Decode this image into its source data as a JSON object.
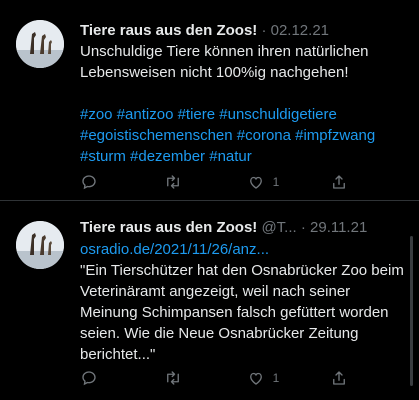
{
  "tweets": [
    {
      "name": "Tiere raus aus den Zoos!",
      "meta": "· 02.12.21",
      "text": "Unschuldige Tiere können ihren natürlichen Lebensweisen nicht 100%ig nachgehen!",
      "hashtags": "#zoo #antizoo #tiere #unschuldigetiere #egoistischemenschen #corona #impfzwang #sturm #dezember #natur",
      "like_count": "1"
    },
    {
      "name": "Tiere raus aus den Zoos!",
      "meta": "@T... · 29.11.21",
      "link": "osradio.de/2021/11/26/anz...",
      "text": "\"Ein Tierschützer hat den Osnabrücker Zoo beim Veterinäramt angezeigt, weil nach seiner Meinung Schimpansen falsch gefüttert worden seien. Wie die Neue Osnabrücker Zeitung berichtet...\"",
      "like_count": "1"
    }
  ],
  "icons": {
    "reply": "reply-icon",
    "retweet": "retweet-icon",
    "like": "like-icon",
    "share": "share-icon"
  },
  "colors": {
    "background": "#000000",
    "text": "#e7e9ea",
    "muted": "#71767b",
    "accent": "#1d9bf0",
    "divider": "#2f3336"
  }
}
